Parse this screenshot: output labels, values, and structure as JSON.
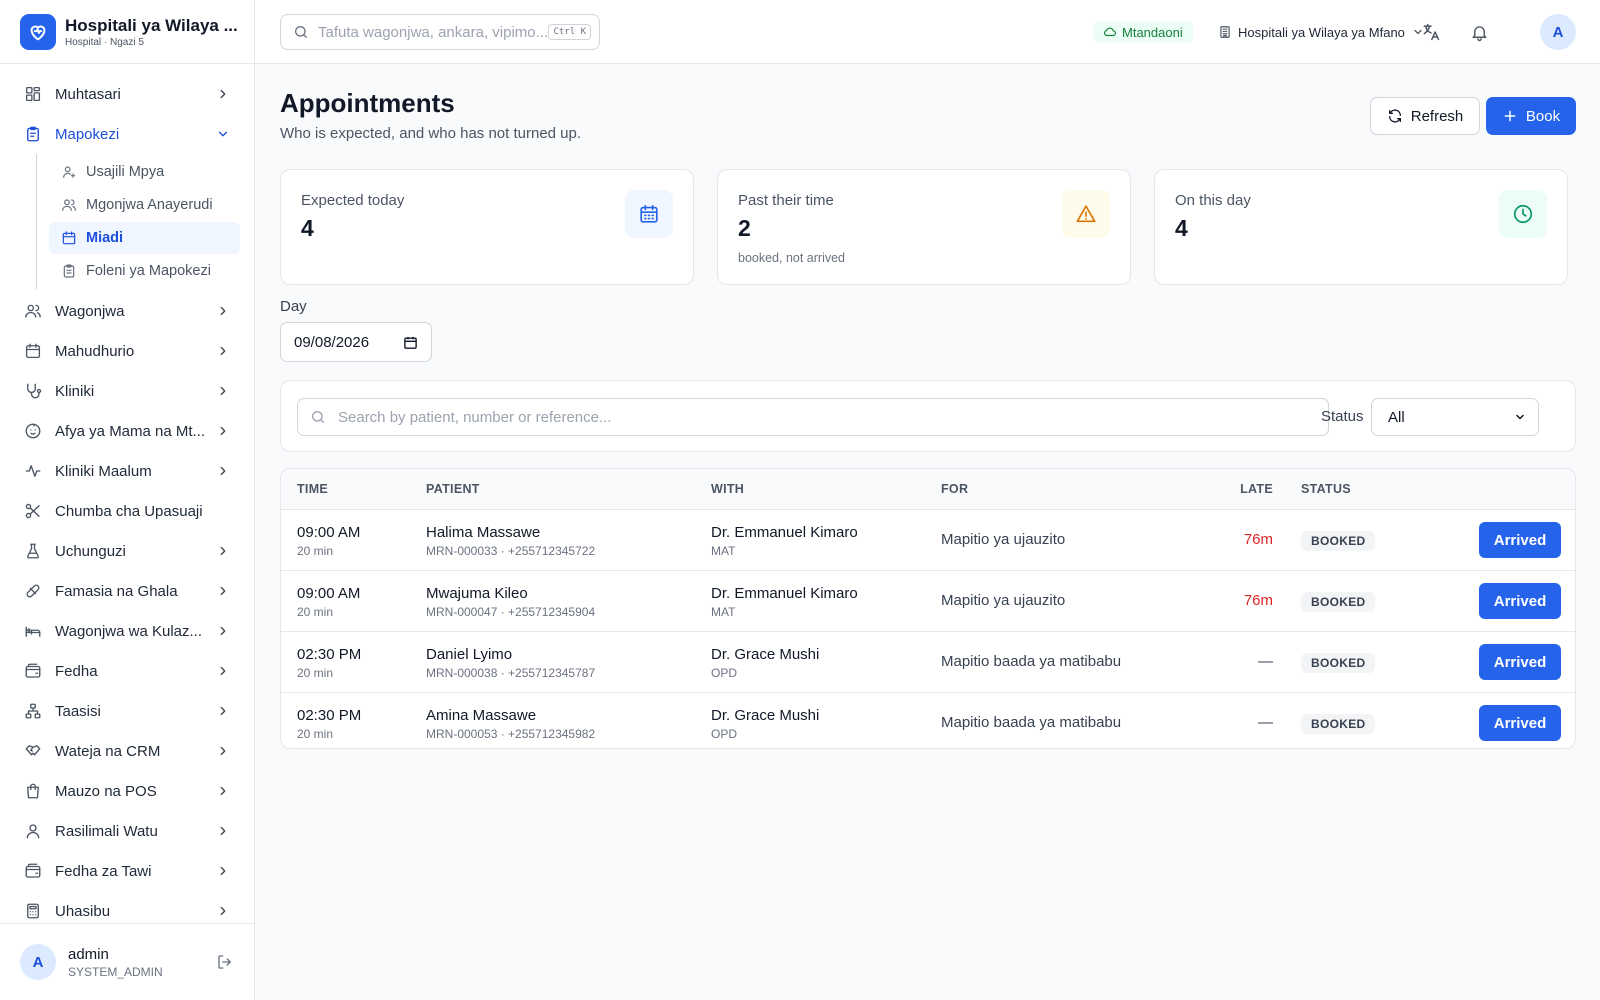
{
  "brand": {
    "title": "Hospitali ya Wilaya ...",
    "subtitle": "Hospital · Ngazi 5"
  },
  "sidebar": {
    "items": [
      {
        "label": "Muhtasari",
        "icon": "dashboard-icon",
        "chevron": "right"
      },
      {
        "label": "Mapokezi",
        "icon": "clipboard-icon",
        "chevron": "down",
        "active": true,
        "children": [
          {
            "label": "Usajili Mpya",
            "icon": "user-plus-icon"
          },
          {
            "label": "Mgonjwa Anayerudi",
            "icon": "users-icon"
          },
          {
            "label": "Miadi",
            "icon": "calendar-icon",
            "active": true
          },
          {
            "label": "Foleni ya Mapokezi",
            "icon": "clipboard-list-icon"
          }
        ]
      },
      {
        "label": "Wagonjwa",
        "icon": "users-icon",
        "chevron": "right"
      },
      {
        "label": "Mahudhurio",
        "icon": "calendar-icon",
        "chevron": "right"
      },
      {
        "label": "Kliniki",
        "icon": "stethoscope-icon",
        "chevron": "right"
      },
      {
        "label": "Afya ya Mama na Mt...",
        "icon": "baby-icon",
        "chevron": "right"
      },
      {
        "label": "Kliniki Maalum",
        "icon": "activity-icon",
        "chevron": "right"
      },
      {
        "label": "Chumba cha Upasuaji",
        "icon": "scissors-icon",
        "chevron": "none"
      },
      {
        "label": "Uchunguzi",
        "icon": "flask-icon",
        "chevron": "right"
      },
      {
        "label": "Famasia na Ghala",
        "icon": "pill-icon",
        "chevron": "right"
      },
      {
        "label": "Wagonjwa wa Kulaz...",
        "icon": "bed-icon",
        "chevron": "right"
      },
      {
        "label": "Fedha",
        "icon": "wallet-icon",
        "chevron": "right"
      },
      {
        "label": "Taasisi",
        "icon": "network-icon",
        "chevron": "right"
      },
      {
        "label": "Wateja na CRM",
        "icon": "handshake-icon",
        "chevron": "right"
      },
      {
        "label": "Mauzo na POS",
        "icon": "shopping-bag-icon",
        "chevron": "right"
      },
      {
        "label": "Rasilimali Watu",
        "icon": "user-icon",
        "chevron": "right"
      },
      {
        "label": "Fedha za Tawi",
        "icon": "wallet-icon",
        "chevron": "right"
      },
      {
        "label": "Uhasibu",
        "icon": "calculator-icon",
        "chevron": "right"
      }
    ]
  },
  "user": {
    "avatar": "A",
    "name": "admin",
    "role": "SYSTEM_ADMIN"
  },
  "topbar": {
    "search_placeholder": "Tafuta wagonjwa, ankara, vipimo...",
    "shortcut": "Ctrl K",
    "status": "Mtandaoni",
    "facility": "Hospitali ya Wilaya ya Mfano",
    "avatar": "A"
  },
  "page": {
    "title": "Appointments",
    "subtitle": "Who is expected, and who has not turned up.",
    "refresh_label": "Refresh",
    "book_label": "Book"
  },
  "stats": [
    {
      "label": "Expected today",
      "value": "4",
      "note": "",
      "icon": "calendar-icon",
      "icon_bg": "#eff6ff",
      "icon_color": "#2563eb"
    },
    {
      "label": "Past their time",
      "value": "2",
      "note": "booked, not arrived",
      "icon": "warning-icon",
      "icon_bg": "#fffbeb",
      "icon_color": "#d97706"
    },
    {
      "label": "On this day",
      "value": "4",
      "note": "",
      "icon": "clock-icon",
      "icon_bg": "#ecfdf5",
      "icon_color": "#059669"
    }
  ],
  "filters": {
    "day_label": "Day",
    "day_value": "09/08/2026",
    "search_placeholder": "Search by patient, number or reference...",
    "status_label": "Status",
    "status_value": "All"
  },
  "table": {
    "columns": [
      "TIME",
      "PATIENT",
      "WITH",
      "FOR",
      "LATE",
      "STATUS"
    ],
    "rows": [
      {
        "time": "09:00 AM",
        "duration": "20 min",
        "patient": "Halima Massawe",
        "patient_meta": "MRN-000033 · +255712345722",
        "with": "Dr. Emmanuel Kimaro",
        "dept": "MAT",
        "for": "Mapitio ya ujauzito",
        "late": "76m",
        "status": "BOOKED",
        "action": "Arrived"
      },
      {
        "time": "09:00 AM",
        "duration": "20 min",
        "patient": "Mwajuma Kileo",
        "patient_meta": "MRN-000047 · +255712345904",
        "with": "Dr. Emmanuel Kimaro",
        "dept": "MAT",
        "for": "Mapitio ya ujauzito",
        "late": "76m",
        "status": "BOOKED",
        "action": "Arrived"
      },
      {
        "time": "02:30 PM",
        "duration": "20 min",
        "patient": "Daniel Lyimo",
        "patient_meta": "MRN-000038 · +255712345787",
        "with": "Dr. Grace Mushi",
        "dept": "OPD",
        "for": "Mapitio baada ya matibabu",
        "late": "—",
        "status": "BOOKED",
        "action": "Arrived"
      },
      {
        "time": "02:30 PM",
        "duration": "20 min",
        "patient": "Amina Massawe",
        "patient_meta": "MRN-000053 · +255712345982",
        "with": "Dr. Grace Mushi",
        "dept": "OPD",
        "for": "Mapitio baada ya matibabu",
        "late": "—",
        "status": "BOOKED",
        "action": "Arrived"
      }
    ]
  },
  "colors": {
    "accent": "#2563eb",
    "late": "#dc2626",
    "online": "#15803d"
  }
}
